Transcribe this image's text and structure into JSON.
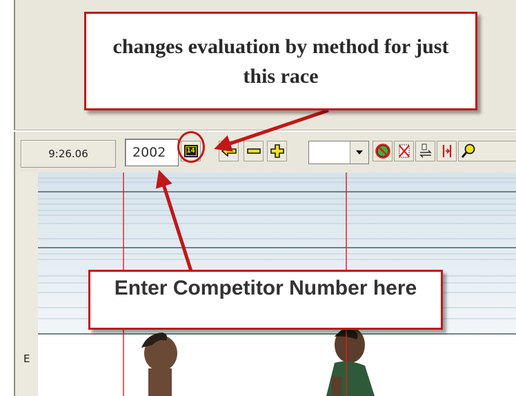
{
  "toolbar": {
    "time_display": "9:26.06",
    "competitor_number": "2002",
    "eval_button_label": "14",
    "dropdown_value": ""
  },
  "image_panel": {
    "lane_label": "E"
  },
  "callouts": {
    "eval_method": "changes evaluation by method for just this race",
    "competitor_number": "Enter Competitor Number here"
  },
  "icons": {
    "eval": "calendar-14-icon",
    "prev": "arrow-left-icon",
    "minus": "minus-icon",
    "plus": "plus-icon",
    "dropdown": "chevron-down-icon",
    "t1": "no-entry-icon",
    "t2": "delete-mark-icon",
    "t3": "swap-icon",
    "t4": "split-icon",
    "t5": "zoom-icon"
  },
  "colors": {
    "annotation_red": "#c01818",
    "panel": "#e9e6dc",
    "eval_icon_bg": "#f5e21c"
  }
}
